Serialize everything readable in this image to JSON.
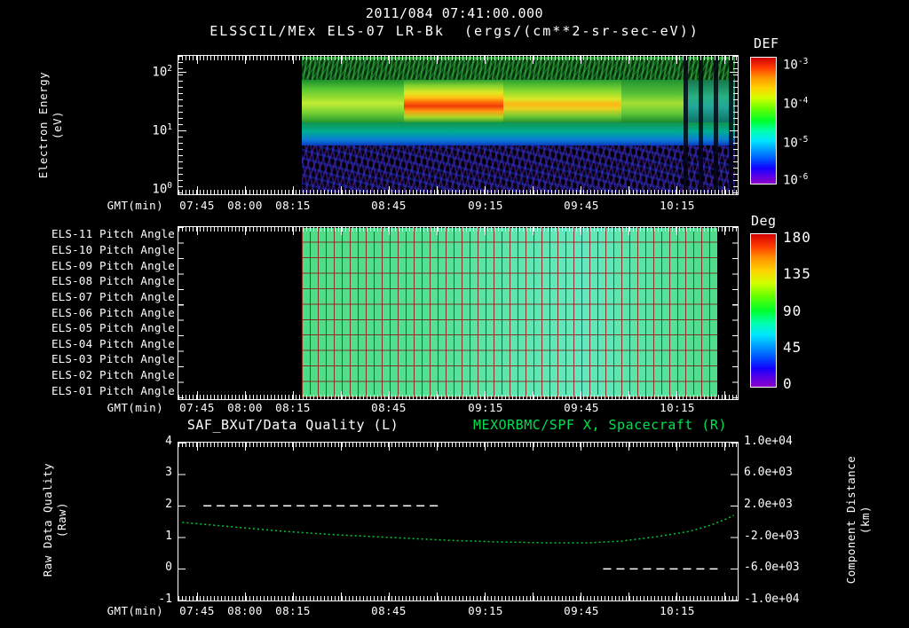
{
  "header": {
    "datetime": "2011/084 07:41:00.000"
  },
  "colors": {
    "background": "#000000",
    "foreground": "#ffffff",
    "accent_green": "#00e050",
    "grid_red": "#8c1414",
    "pitch_field_green": "#52de8e",
    "spacecraft_curve_green": "#00c838"
  },
  "time_axis": {
    "label": "GMT(min)",
    "ticks": [
      "07:45",
      "08:00",
      "08:15",
      "08:45",
      "09:15",
      "09:45",
      "10:15"
    ]
  },
  "panel1": {
    "title": "ELSSCIL/MEx ELS-07 LR-Bk  (ergs/(cm**2-sr-sec-eV))",
    "ylabel": [
      "Electron Energy",
      "(eV)"
    ],
    "yticks": [
      {
        "b": "10",
        "e": "2"
      },
      {
        "b": "10",
        "e": "1"
      },
      {
        "b": "10",
        "e": "0"
      }
    ],
    "colorbar": {
      "title": "DEF",
      "ticks": [
        {
          "b": "10",
          "e": "-3"
        },
        {
          "b": "10",
          "e": "-4"
        },
        {
          "b": "10",
          "e": "-5"
        },
        {
          "b": "10",
          "e": "-6"
        }
      ]
    }
  },
  "panel2": {
    "row_labels": [
      "ELS-11 Pitch Angle",
      "ELS-10 Pitch Angle",
      "ELS-09 Pitch Angle",
      "ELS-08 Pitch Angle",
      "ELS-07 Pitch Angle",
      "ELS-06 Pitch Angle",
      "ELS-05 Pitch Angle",
      "ELS-04 Pitch Angle",
      "ELS-03 Pitch Angle",
      "ELS-02 Pitch Angle",
      "ELS-01 Pitch Angle"
    ],
    "colorbar": {
      "title": "Deg",
      "ticks": [
        "180",
        "135",
        "90",
        "45",
        "0"
      ]
    }
  },
  "panel3": {
    "title_left": "SAF_BXuT/Data Quality (L)",
    "title_right": "MEXORBMC/SPF X, Spacecraft (R)",
    "ylabel_left": [
      "Raw Data Quality",
      "(Raw)"
    ],
    "ylabel_right": [
      "Component Distance",
      "(km)"
    ],
    "yticks_left": [
      "4",
      "3",
      "2",
      "1",
      "0",
      "-1"
    ],
    "yticks_right": [
      "1.0e+04",
      "6.0e+03",
      "2.0e+03",
      "-2.0e+03",
      "-6.0e+03",
      "-1.0e+04"
    ]
  },
  "chart_data": [
    {
      "type": "heatmap",
      "title": "ELSSCIL/MEx ELS-07 LR-Bk",
      "units": "ergs/(cm**2-sr-sec-eV)",
      "xlabel": "GMT(min)",
      "ylabel": "Electron Energy (eV)",
      "x_range": [
        "07:39",
        "10:33"
      ],
      "data_time_range": [
        "08:19",
        "10:33"
      ],
      "y_log_range_eV": [
        1,
        300
      ],
      "color_scale": {
        "label": "DEF",
        "log10_range": [
          -6,
          -3
        ]
      },
      "features": [
        {
          "time": [
            "08:19",
            "10:05"
          ],
          "energy_eV": [
            10,
            100
          ],
          "flux": "1e-4 to 1e-3, bright green-yellow band"
        },
        {
          "time": [
            "08:45",
            "09:05"
          ],
          "energy_eV": [
            20,
            60
          ],
          "flux": "~1e-3 red/orange peak"
        },
        {
          "time": [
            "09:10",
            "09:40"
          ],
          "energy_eV": [
            20,
            70
          ],
          "flux": "orange streaks ~3e-4"
        },
        {
          "time": [
            "08:19",
            "10:33"
          ],
          "energy_eV": [
            1,
            5
          ],
          "flux": "~1e-6 blue/purple speckle"
        },
        {
          "time": [
            "10:05",
            "10:33"
          ],
          "energy_eV": [
            10,
            100
          ],
          "flux": "~1e-5 cyan, intermittent with vertical data gaps"
        }
      ]
    },
    {
      "type": "heatmap",
      "title": "ELS Pitch Angles",
      "rows": [
        "ELS-11",
        "ELS-10",
        "ELS-09",
        "ELS-08",
        "ELS-07",
        "ELS-06",
        "ELS-05",
        "ELS-04",
        "ELS-03",
        "ELS-02",
        "ELS-01"
      ],
      "x_range": [
        "07:39",
        "10:33"
      ],
      "data_time_range": [
        "08:19",
        "10:22"
      ],
      "color_scale": {
        "label": "Deg",
        "range": [
          0,
          180
        ]
      },
      "values": "approximately 90-105 deg (green) on all anodes; slightly lower ~75-85 deg (cyan tint) between 09:30 and 10:15; red/maroon grid lines overlay"
    },
    {
      "type": "line",
      "xlabel": "GMT(min)",
      "axes": {
        "t0_h": 7.65,
        "t1_h": 10.56,
        "left_range": [
          -1,
          4
        ],
        "right_range": [
          -10000,
          10000
        ]
      },
      "series": [
        {
          "name": "SAF_BXuT/Data Quality (L)",
          "axis": "left",
          "style": "dashed-white",
          "segments": [
            {
              "t_h": [
                7.78,
                9.02
              ],
              "value": 2
            },
            {
              "t_h": [
                9.86,
                10.47
              ],
              "value": 0
            }
          ]
        },
        {
          "name": "MEXORBMC/SPF X, Spacecraft (R)",
          "axis": "right",
          "style": "dotted-green",
          "points": [
            [
              7.67,
              -100
            ],
            [
              7.93,
              -670
            ],
            [
              8.2,
              -1240
            ],
            [
              8.48,
              -1690
            ],
            [
              8.76,
              -2020
            ],
            [
              9.04,
              -2360
            ],
            [
              9.31,
              -2580
            ],
            [
              9.59,
              -2700
            ],
            [
              9.78,
              -2700
            ],
            [
              9.96,
              -2470
            ],
            [
              10.14,
              -1910
            ],
            [
              10.31,
              -1240
            ],
            [
              10.42,
              -450
            ],
            [
              10.49,
              220
            ],
            [
              10.54,
              790
            ]
          ]
        }
      ]
    }
  ]
}
